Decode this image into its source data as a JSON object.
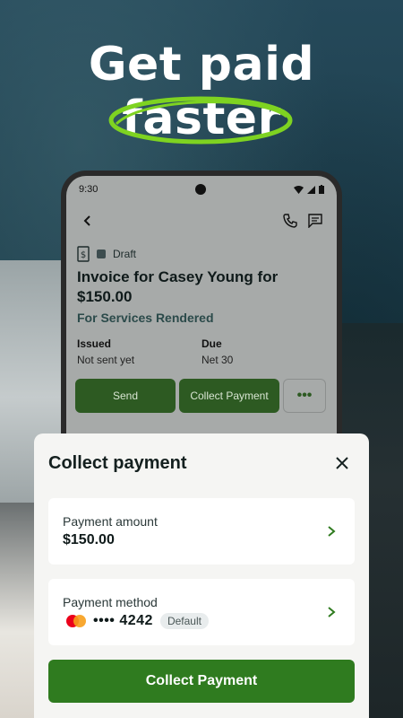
{
  "promo": {
    "headline_line1": "Get paid",
    "headline_line2": "faster"
  },
  "phone": {
    "status_time": "9:30",
    "invoice": {
      "status": "Draft",
      "title": "Invoice for Casey Young for $150.00",
      "subtitle": "For Services Rendered",
      "issued_label": "Issued",
      "issued_value": "Not sent yet",
      "due_label": "Due",
      "due_value": "Net 30",
      "send_label": "Send",
      "collect_label": "Collect Payment",
      "more_label": "•••"
    }
  },
  "sheet": {
    "title": "Collect payment",
    "amount_label": "Payment amount",
    "amount_value": "$150.00",
    "method_label": "Payment method",
    "card_masked": "•••• 4242",
    "card_badge": "Default",
    "primary_button": "Collect Payment"
  },
  "colors": {
    "accent_green": "#2f7b1f",
    "highlight_green": "#7ed321",
    "sheet_bg": "#f5f5f3"
  },
  "icons": [
    "back-arrow-icon",
    "phone-icon",
    "message-icon",
    "invoice-icon",
    "close-icon",
    "chevron-right-icon",
    "mastercard-icon",
    "wifi-icon",
    "signal-icon",
    "battery-icon"
  ]
}
